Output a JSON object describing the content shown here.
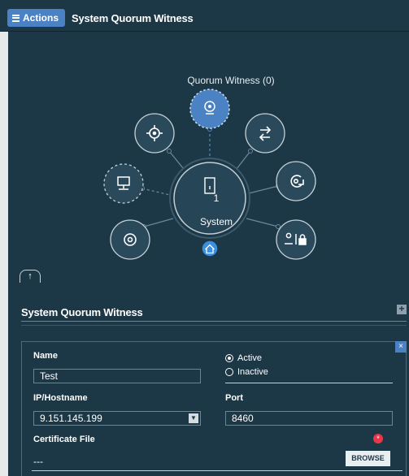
{
  "header": {
    "actions_label": "Actions",
    "title": "System Quorum Witness"
  },
  "topology": {
    "quorum_witness_label": "Quorum Witness (0)",
    "system_count": "1",
    "system_label": "System",
    "nodes": [
      {
        "name": "quorum-witness",
        "icon": "webcam-icon",
        "dashed": true
      },
      {
        "name": "target",
        "icon": "crosshair-icon",
        "dashed": false
      },
      {
        "name": "replication",
        "icon": "transfer-arrows-icon",
        "dashed": false
      },
      {
        "name": "hosts",
        "icon": "monitor-icon",
        "dashed": true
      },
      {
        "name": "storage-copy",
        "icon": "disc-arrow-icon",
        "dashed": false
      },
      {
        "name": "volumes",
        "icon": "disc-icon",
        "dashed": false
      },
      {
        "name": "access",
        "icon": "user-lock-icon",
        "dashed": false
      }
    ],
    "collapse_glyph": "↑"
  },
  "panel": {
    "title": "System Quorum Witness",
    "add_glyph": "+",
    "form": {
      "close_glyph": "×",
      "name_label": "Name",
      "name_value": "Test",
      "status_options": [
        "Active",
        "Inactive"
      ],
      "status_selected": "Active",
      "ip_label": "IP/Hostname",
      "ip_value": "9.151.145.199",
      "port_label": "Port",
      "port_value": "8460",
      "cert_label": "Certificate File",
      "cert_value": "---",
      "browse_label": "BROWSE",
      "required_glyph": "*"
    }
  },
  "colors": {
    "background": "#1c3847",
    "accent": "#4b82c3",
    "node_fill": "#2a4a5c",
    "required": "#e8364a"
  }
}
